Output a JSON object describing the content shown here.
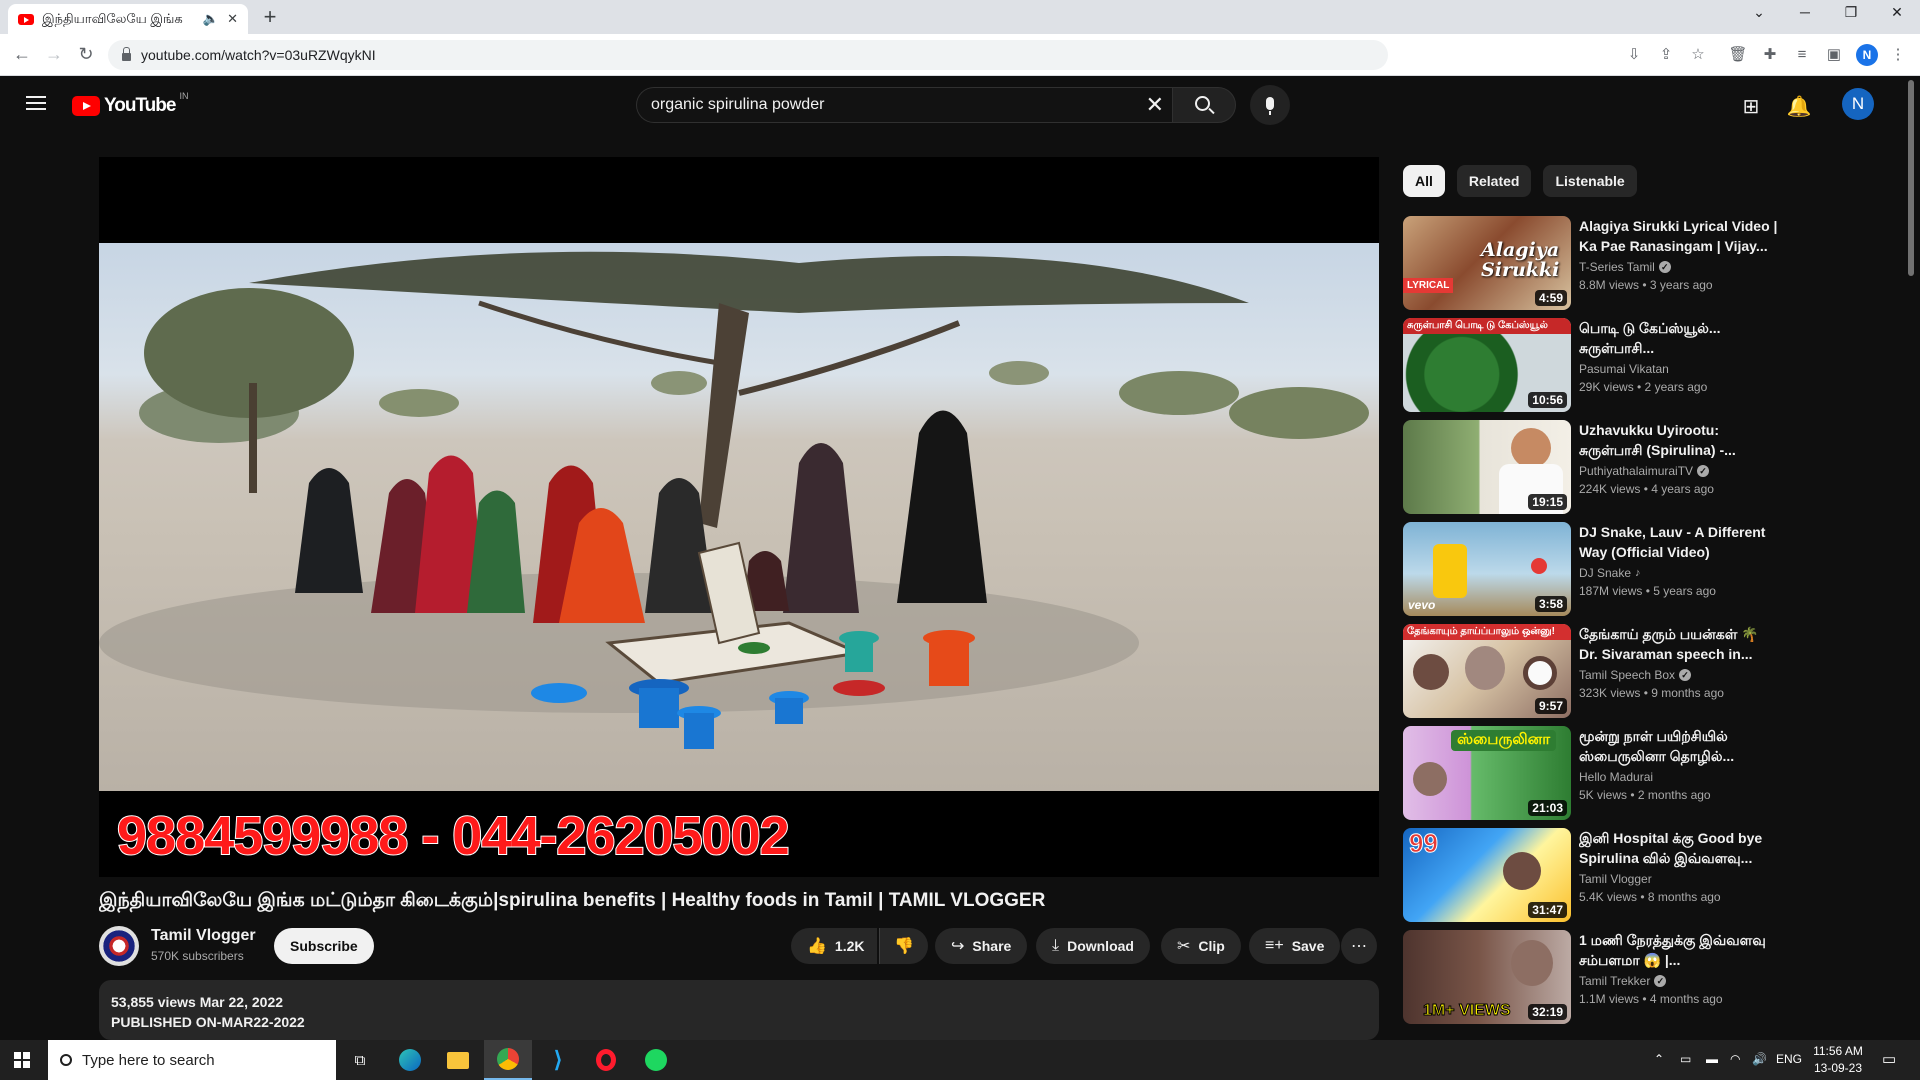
{
  "browser": {
    "tab_title": "இந்தியாவிலேயே இங்க",
    "url": "youtube.com/watch?v=03uRZWqykNI",
    "profile_initial": "N"
  },
  "masthead": {
    "logo_text": "YouTube",
    "country_code": "IN",
    "search_value": "organic spirulina powder",
    "avatar_initial": "N"
  },
  "video": {
    "overlay_text": "9884599988 - 044-26205002",
    "title": "இந்தியாவிலேயே இங்க மட்டும்தா கிடைக்கும்|spirulina benefits | Healthy foods in Tamil | TAMIL VLOGGER",
    "channel_name": "Tamil Vlogger",
    "subscribers": "570K subscribers",
    "subscribe_label": "Subscribe",
    "likes": "1.2K",
    "share_label": "Share",
    "download_label": "Download",
    "clip_label": "Clip",
    "save_label": "Save",
    "views_date": "53,855 views  Mar 22, 2022",
    "description_line": "PUBLISHED ON-MAR22-2022"
  },
  "chips": [
    "All",
    "Related",
    "Listenable"
  ],
  "recommendations": [
    {
      "title": "Alagiya Sirukki Lyrical Video | Ka Pae Ranasingam | Vijay...",
      "channel": "T-Series Tamil",
      "verified": true,
      "meta": "8.8M views • 3 years ago",
      "duration": "4:59",
      "thumb_label": "Alagiya Sirukki",
      "badge": "LYRICAL"
    },
    {
      "title": "பொடி டு கேப்ஸ்யூல்... சுருள்பாசி...",
      "channel": "Pasumai Vikatan",
      "verified": false,
      "meta": "29K views • 2 years ago",
      "duration": "10:56",
      "thumb_label": "சுருள்பாசி பொடி டு கேப்ஸ்யூல்"
    },
    {
      "title": "Uzhavukku Uyirootu: சுருள்பாசி (Spirulina) -...",
      "channel": "PuthiyathalaimuraiTV",
      "verified": true,
      "meta": "224K views • 4 years ago",
      "duration": "19:15"
    },
    {
      "title": "DJ Snake, Lauv - A Different Way (Official Video)",
      "channel": "DJ Snake",
      "verified": false,
      "music": true,
      "meta": "187M views • 5 years ago",
      "duration": "3:58",
      "thumb_label": "vevo"
    },
    {
      "title": "தேங்காய் தரும் பயன்கள் 🌴 Dr. Sivaraman speech in...",
      "channel": "Tamil Speech Box",
      "verified": true,
      "meta": "323K views • 9 months ago",
      "duration": "9:57",
      "thumb_label": "தேங்காயும் தாய்ப்பாலும் ஒன்னு!"
    },
    {
      "title": "மூன்று நாள் பயிற்சியில் ஸ்பைருலினா தொழில்...",
      "channel": "Hello Madurai",
      "verified": false,
      "meta": "5K views • 2 months ago",
      "duration": "21:03",
      "thumb_label": "ஸ்பைருலினா"
    },
    {
      "title": "இனி Hospital க்கு Good bye Spirulina வில் இவ்வளவு...",
      "channel": "Tamil Vlogger",
      "verified": false,
      "meta": "5.4K views • 8 months ago",
      "duration": "31:47",
      "thumb_label": "99"
    },
    {
      "title": "1 மணி நேரத்துக்கு இவ்வளவு சம்பளமா 😱 |...",
      "channel": "Tamil Trekker",
      "verified": true,
      "meta": "1.1M views • 4 months ago",
      "duration": "32:19",
      "thumb_label": "1M+ VIEWS"
    }
  ],
  "taskbar": {
    "search_placeholder": "Type here to search",
    "lang": "ENG",
    "time": "11:56 AM",
    "date": "13-09-23"
  },
  "colors": {
    "yt_red": "#ff0000",
    "background": "#0f0f0f",
    "chip_bg": "#272727"
  }
}
